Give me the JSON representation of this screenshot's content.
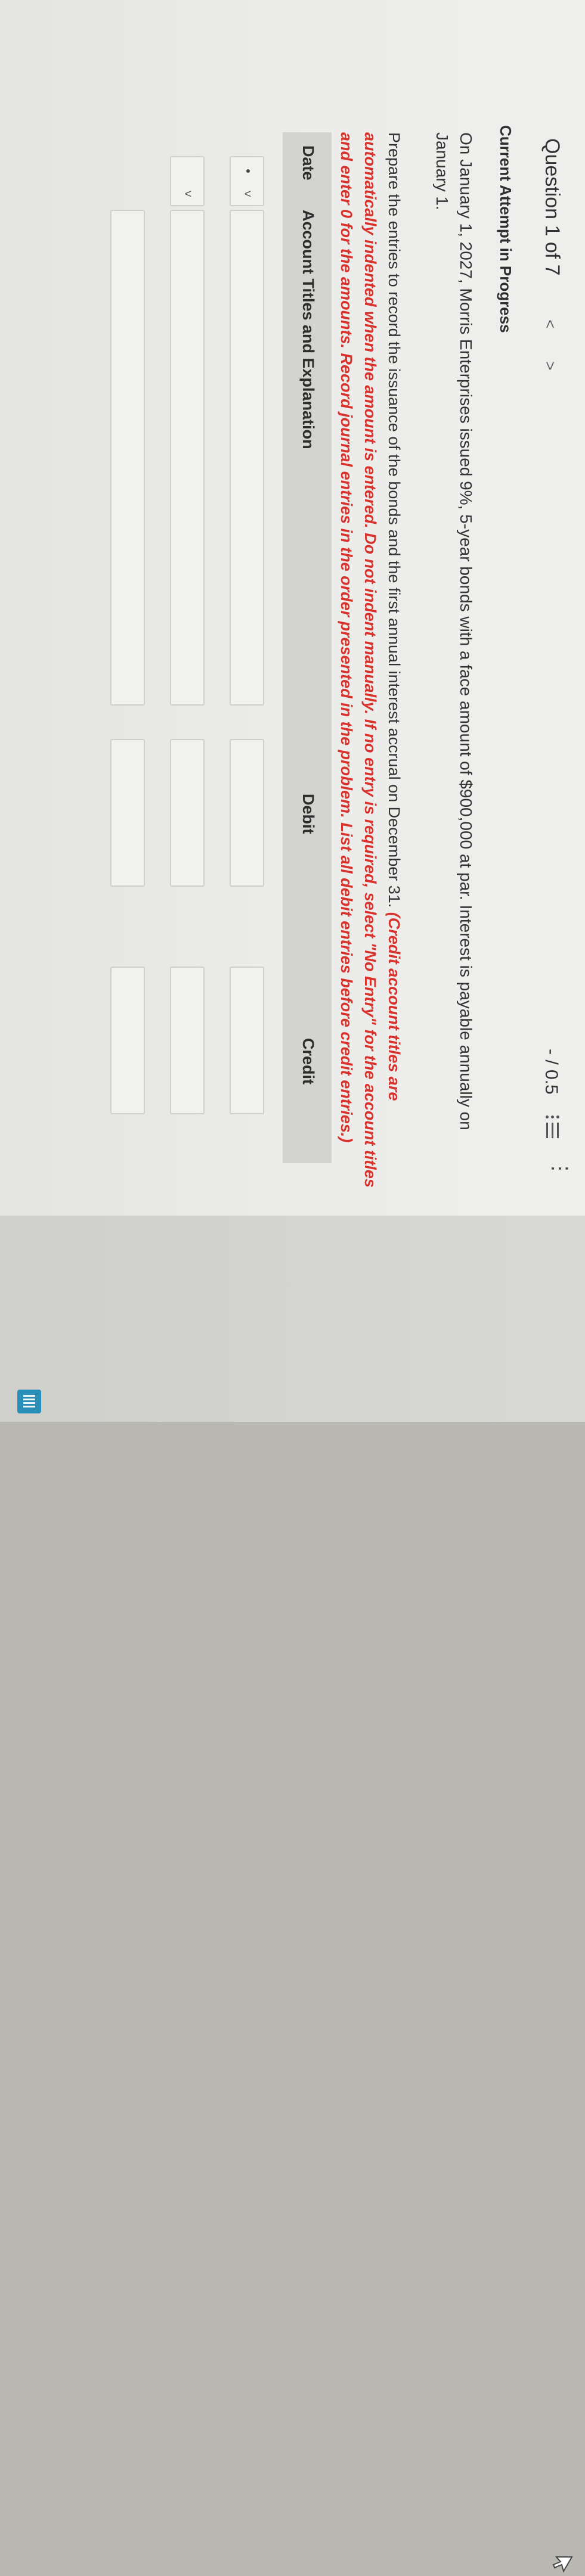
{
  "header": {
    "question_label": "Question 1 of 7",
    "prev_icon": "chevron-left-icon",
    "next_icon": "chevron-right-icon",
    "prev_glyph": "<",
    "next_glyph": ">",
    "score": "- / 0.5",
    "list_icon": "list-icon",
    "more_icon": "more-vertical-icon",
    "more_glyph": "⋮"
  },
  "attempt_status": "Current Attempt in Progress",
  "problem_text": "On January 1, 2027, Morris Enterprises issued 9%, 5-year bonds with a face amount of $900,000 at par. Interest is payable annually on January 1.",
  "instruction": {
    "plain": "Prepare the entries to record the issuance of the bonds and the first annual interest accrual on December 31. ",
    "emphasis": "(Credit account titles are automatically indented when the amount is entered. Do not indent manually. If no entry is required, select \"No Entry\" for the account titles and enter 0 for the amounts. Record journal entries in the order presented in the problem. List all debit entries before credit entries.)"
  },
  "table": {
    "headers": {
      "date": "Date",
      "account": "Account Titles and Explanation",
      "debit": "Debit",
      "credit": "Credit"
    },
    "rows": [
      {
        "date": "",
        "account": "",
        "debit": "",
        "credit": "",
        "has_date_select": true
      },
      {
        "date": "",
        "account": "",
        "debit": "",
        "credit": "",
        "has_date_select": true
      },
      {
        "date": "",
        "account": "",
        "debit": "",
        "credit": "",
        "has_date_select": false
      }
    ]
  },
  "colors": {
    "instruction_red": "#d9312b",
    "header_bg": "#d3d3d0",
    "badge_blue": "#2a8fb8"
  }
}
